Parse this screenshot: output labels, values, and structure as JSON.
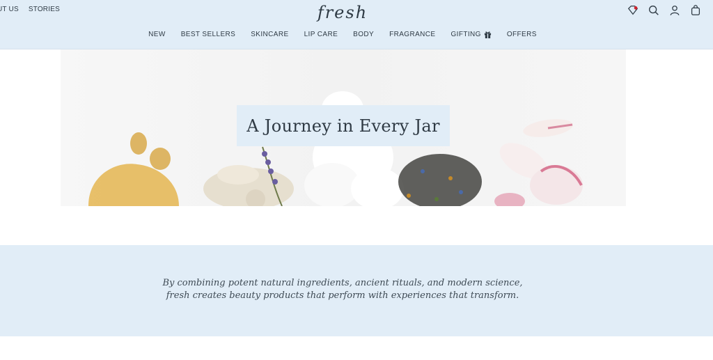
{
  "header": {
    "util_links": [
      "UT US",
      "STORIES"
    ],
    "logo": "fresh",
    "icons": [
      "loyalty-icon",
      "search-icon",
      "account-icon",
      "bag-icon"
    ],
    "accent": "#e1edf7"
  },
  "nav": {
    "items": [
      {
        "label": "NEW"
      },
      {
        "label": "BEST SELLERS"
      },
      {
        "label": "SKINCARE"
      },
      {
        "label": "LIP CARE"
      },
      {
        "label": "BODY"
      },
      {
        "label": "FRAGRANCE"
      },
      {
        "label": "GIFTING"
      },
      {
        "label": "OFFERS"
      }
    ]
  },
  "hero": {
    "title": "A Journey in Every Jar"
  },
  "mission": {
    "line1": "By combining potent natural ingredients, ancient rituals, and modern science,",
    "line2": "fresh creates beauty products that perform with experiences that transform."
  }
}
